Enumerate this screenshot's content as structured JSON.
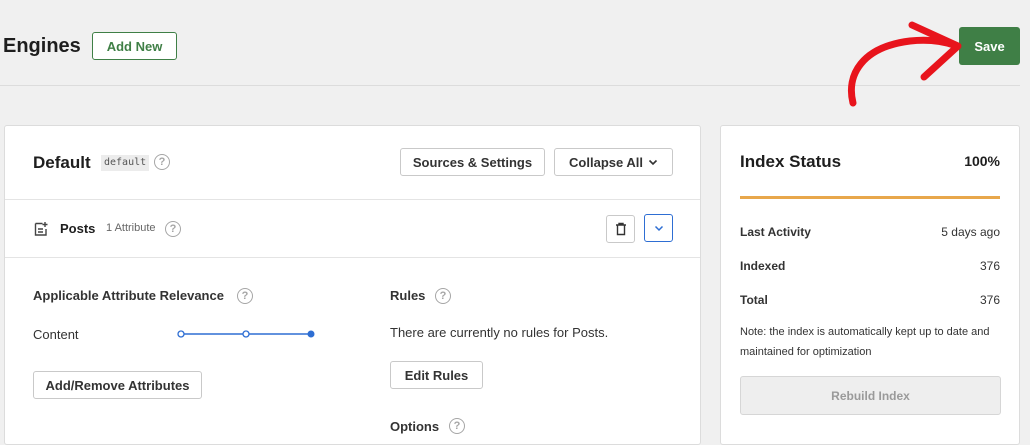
{
  "header": {
    "title": "Engines",
    "add_new_label": "Add New",
    "save_label": "Save"
  },
  "engine": {
    "name": "Default",
    "slug": "default",
    "sources_settings_label": "Sources & Settings",
    "collapse_all_label": "Collapse All",
    "source": {
      "label": "Posts",
      "attribute_count": "1 Attribute"
    },
    "relevance": {
      "title": "Applicable Attribute Relevance",
      "attribute": "Content",
      "level": 1.0,
      "add_remove_label": "Add/Remove Attributes"
    },
    "rules": {
      "title": "Rules",
      "empty_text": "There are currently no rules for Posts.",
      "edit_label": "Edit Rules"
    },
    "options": {
      "title": "Options"
    }
  },
  "index_status": {
    "title": "Index Status",
    "percent": "100%",
    "progress": 1.0,
    "progress_color": "#e8a74b",
    "stats": [
      {
        "label": "Last Activity",
        "value": "5 days ago"
      },
      {
        "label": "Indexed",
        "value": "376"
      },
      {
        "label": "Total",
        "value": "376"
      }
    ],
    "note": "Note: the index is automatically kept up to date and maintained for optimization",
    "rebuild_label": "Rebuild Index"
  },
  "colors": {
    "accent_green": "#3f7f46",
    "annotation_red": "#e8141c",
    "slider_blue": "#2e6ed3"
  },
  "icons": {
    "help": "question-circle-icon",
    "posts": "document-plus-icon",
    "delete": "trash-icon",
    "expand": "chevron-down-icon",
    "annotation": "red-arrow-icon"
  }
}
